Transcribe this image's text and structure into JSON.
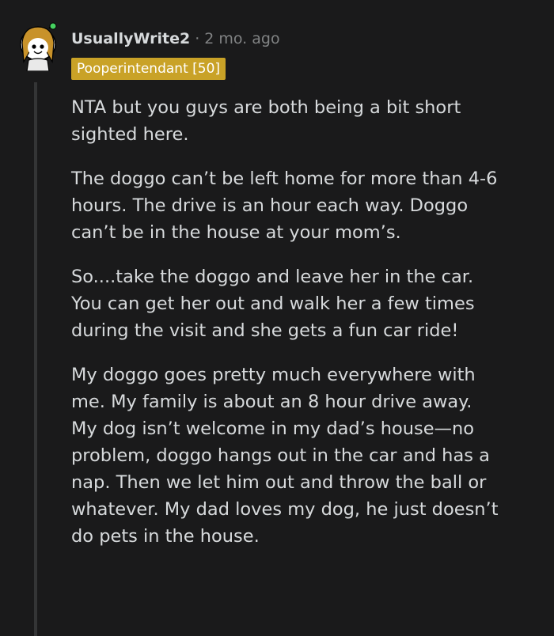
{
  "comment": {
    "username": "UsuallyWrite2",
    "separator": "·",
    "timestamp": "2 mo. ago",
    "flair": "Pooperintendant [50]",
    "avatar_icon": "snoo-avatar-icon",
    "colors": {
      "background": "#1a1a1b",
      "text": "#d7dadc",
      "muted": "#818384",
      "flair_bg": "#c9a227",
      "thread_line": "#343536"
    },
    "paragraphs": [
      {
        "lines": [
          "NTA but you guys are both being a bit short",
          "sighted here."
        ]
      },
      {
        "lines": [
          "The doggo can’t be left home for more than 4-6",
          "hours. The drive is an hour each way. Doggo",
          "can’t be in the house at your mom’s."
        ]
      },
      {
        "lines": [
          "So....take the doggo and leave her in the car.",
          "You can get her out and walk her a few times",
          "during the visit and she gets a fun car ride!"
        ]
      },
      {
        "lines": [
          "My doggo goes pretty much everywhere with",
          "me. My family is about an 8 hour drive away.",
          "My dog isn’t welcome in my dad’s house—no",
          "problem, doggo hangs out in the car and has a",
          "nap. Then we let him out and throw the ball or",
          "whatever. My dad loves my dog, he just doesn’t",
          "do pets in the house."
        ]
      }
    ]
  }
}
